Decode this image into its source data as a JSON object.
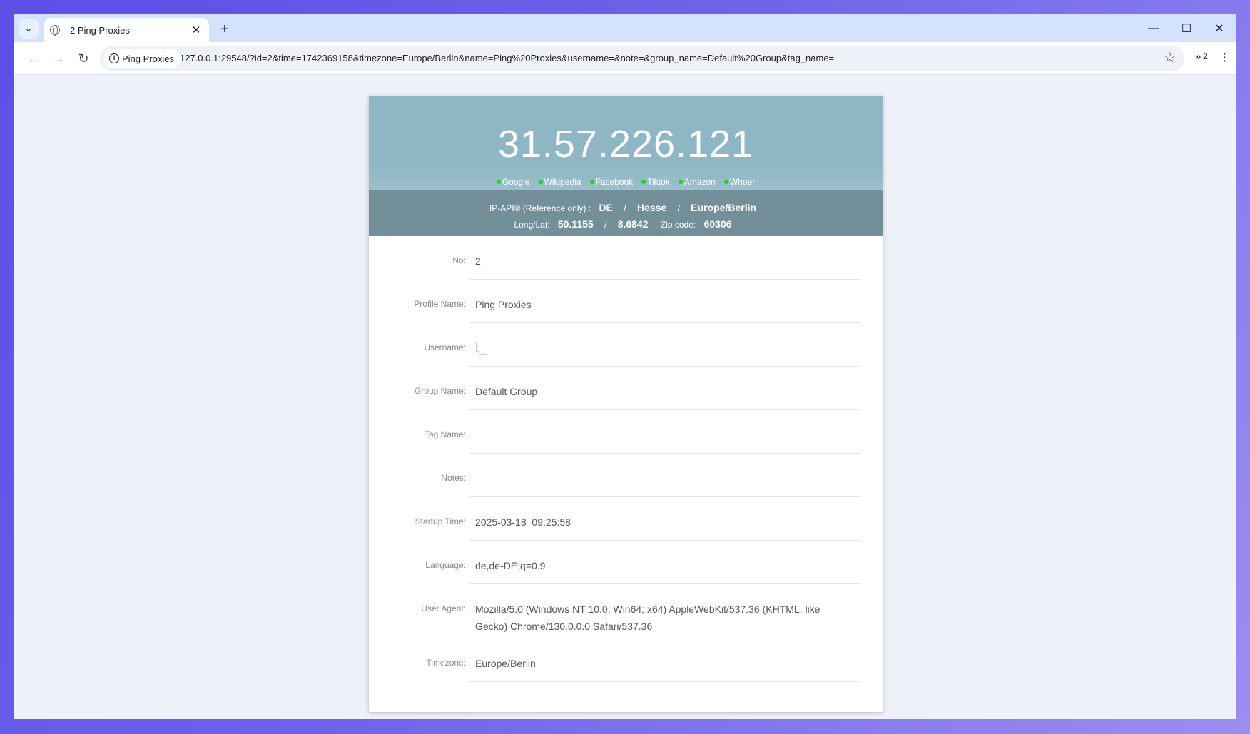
{
  "browser": {
    "tab_title": "2 Ping Proxies",
    "site_chip": "Ping Proxies",
    "url": "127.0.0.1:29548/?id=2&time=1742369158&timezone=Europe/Berlin&name=Ping%20Proxies&username=&note=&group_name=Default%20Group&tag_name=",
    "extensions_count": "2"
  },
  "hero": {
    "ip": "31.57.226.121",
    "links": [
      "Google",
      "Wikipedia",
      "Facebook",
      "Tiktok",
      "Amazon",
      "Whoer"
    ],
    "status_color": "#1fd41f"
  },
  "geo": {
    "label": "IP-API®  (Reference only)  :",
    "country": "DE",
    "region": "Hesse",
    "timezone": "Europe/Berlin",
    "longlat_label": "Long/Lat:",
    "lat": "50.1155",
    "lon": "8.6842",
    "zip_label": "Zip code:",
    "zip": "60306",
    "sep": "/"
  },
  "fields": {
    "no_label": "No:",
    "no_value": "2",
    "profile_label": "Profile Name:",
    "profile_value": "Ping Proxies",
    "username_label": "Username:",
    "group_label": "Group Name:",
    "group_value": "Default Group",
    "tag_label": "Tag Name:",
    "tag_value": "",
    "notes_label": "Notes:",
    "notes_value": "",
    "startup_label": "Startup Time:",
    "startup_value": "2025-03-18  09:25:58",
    "language_label": "Language:",
    "language_value": "de,de-DE;q=0.9",
    "ua_label": "User Agent:",
    "ua_value": "Mozilla/5.0 (Windows NT 10.0; Win64; x64) AppleWebKit/537.36 (KHTML, like Gecko) Chrome/130.0.0.0 Safari/537.36",
    "tz_label": "Timezone:",
    "tz_value": "Europe/Berlin"
  }
}
